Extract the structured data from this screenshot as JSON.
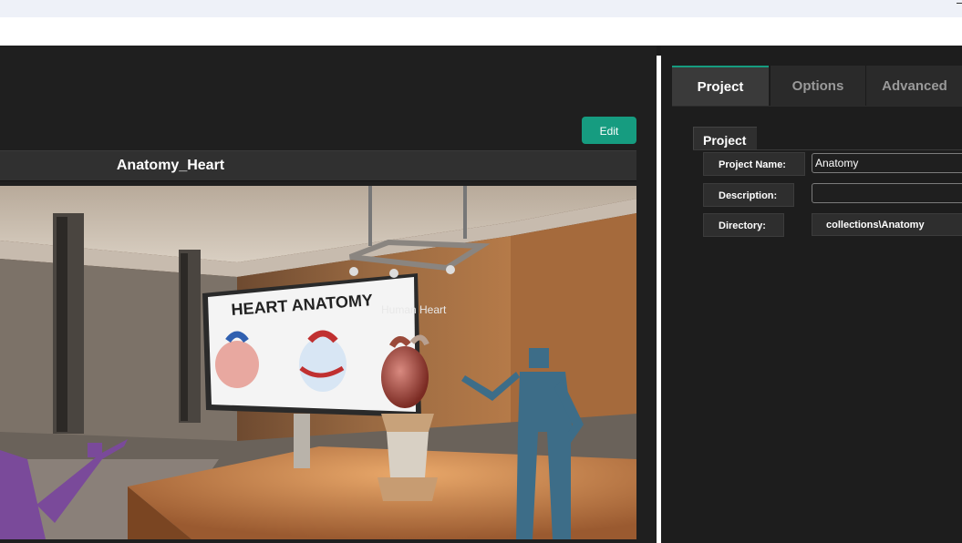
{
  "window": {
    "minimize_glyph": "_"
  },
  "editor": {
    "edit_label": "Edit",
    "scene_title": "Anatomy_Heart",
    "scene": {
      "poster_title": "HEART ANATOMY",
      "hover_label": "Human Heart"
    }
  },
  "tabs": [
    {
      "label": "Project",
      "active": true
    },
    {
      "label": "Options",
      "active": false
    },
    {
      "label": "Advanced",
      "active": false
    }
  ],
  "project": {
    "group_label": "Project",
    "name_label": "Project Name:",
    "name_value": "Anatomy",
    "description_label": "Description:",
    "description_value": "",
    "directory_label": "Directory:",
    "directory_value": "collections\\Anatomy"
  },
  "colors": {
    "accent": "#169c80",
    "background": "#1b1b1b",
    "panel": "#2e2e2e"
  }
}
